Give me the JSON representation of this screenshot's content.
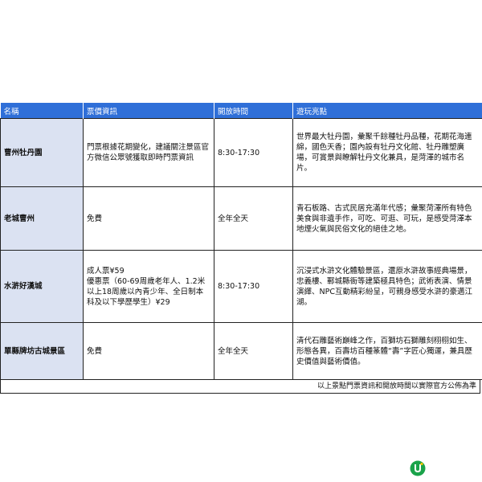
{
  "table": {
    "headers": [
      "名稱",
      "票價資訊",
      "開放時間",
      "遊玩亮點"
    ],
    "rows": [
      {
        "name": "曹州牡丹園",
        "ticket": "門票根據花期變化，建議關注景區官方微信公眾號獲取即時門票資訊",
        "hours": "8:30-17:30",
        "highlights": "世界最大牡丹園，彙聚千餘種牡丹品種，花期花海連綿，國色天香；園內設有牡丹文化館、牡丹雕塑廣場，可賞景與瞭解牡丹文化兼具，是菏澤的城市名片。"
      },
      {
        "name": "老城曹州",
        "ticket": "免費",
        "hours": "全年全天",
        "highlights": "青石板路、古式民居充滿年代感；彙聚菏澤所有特色美食與非遺手作，可吃、可逛、可玩，是感受菏澤本地煙火氣與民俗文化的絕佳之地。"
      },
      {
        "name": "水滸好漢城",
        "ticket": "成人票¥59\n優惠票（60-69周歲老年人、1.2米以上18周歲以內青少年、全日制本科及以下學歷學生）¥29",
        "hours": "8:30-17:30",
        "highlights": "沉浸式水滸文化體驗景區，還原水滸故事經典場景，忠義樓、鄆城縣衙等建築極具特色；武術表演、情景演繹、NPC互動精彩紛呈，可親身感受水滸的豪邁江湖。"
      },
      {
        "name": "單縣牌坊古城景區",
        "ticket": "免費",
        "hours": "全年全天",
        "highlights": "清代石雕藝術巔峰之作，百獅坊石獅雕刻栩栩如生、形態各異，百壽坊百種篆體“壽”字匠心獨運，兼具歷史價值與藝術價值。"
      }
    ],
    "footnote": "以上景點門票資訊和開放時間以實際官方公佈為準"
  },
  "logo": {
    "colors": {
      "primary": "#1aa34a",
      "accent": "#f2c400"
    }
  }
}
